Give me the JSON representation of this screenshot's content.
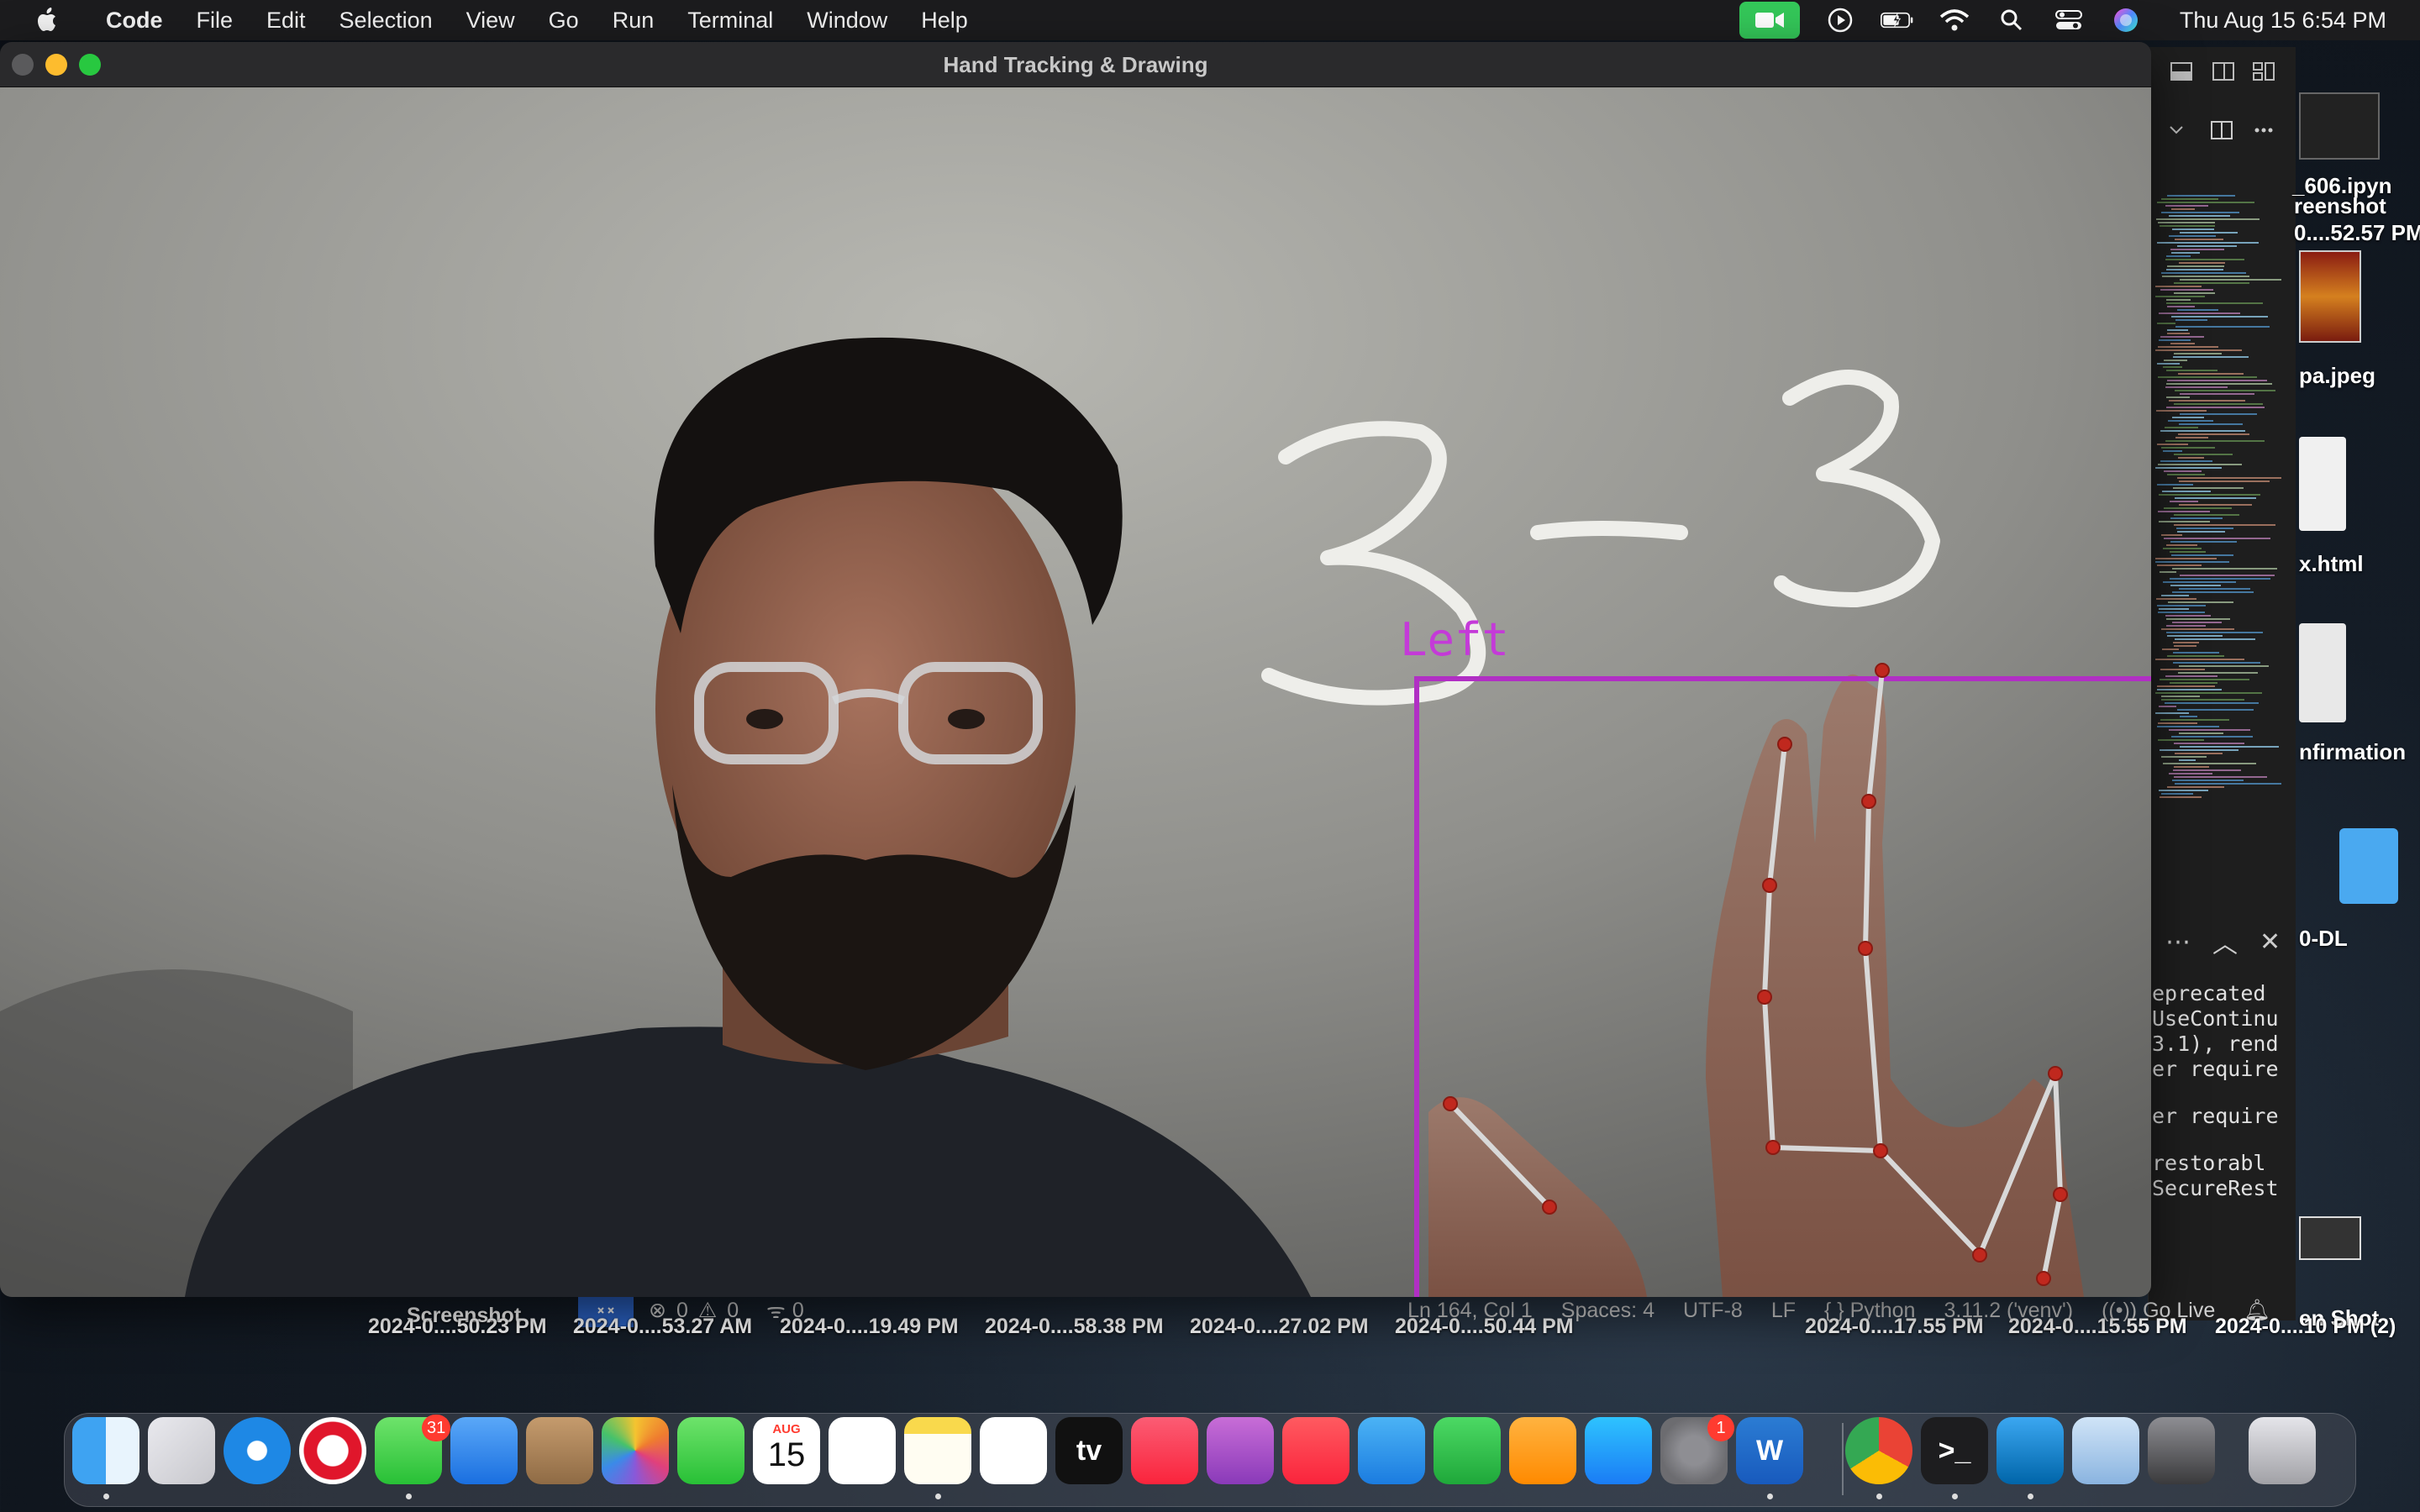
{
  "menubar": {
    "app_name": "Code",
    "items": [
      "File",
      "Edit",
      "Selection",
      "View",
      "Go",
      "Run",
      "Terminal",
      "Window",
      "Help"
    ],
    "clock": "Thu Aug 15  6:54 PM"
  },
  "camera_window": {
    "title": "Hand Tracking & Drawing",
    "drawing_text": "3-3",
    "hand_label": "Left",
    "accent_color": "#b12fc4"
  },
  "vscode": {
    "terminal_lines": [
      "eprecated",
      "UseContinu",
      "",
      "3.1), rend",
      "",
      "er require",
      "er require",
      "restorabl",
      "SecureRest"
    ],
    "status": {
      "errors": "0",
      "warnings": "0",
      "ports": "0",
      "position": "Ln 164, Col 1",
      "spaces": "Spaces: 4",
      "encoding": "UTF-8",
      "eol": "LF",
      "language": "Python",
      "interpreter": "3.11.2 ('venv')",
      "go_live": "Go Live"
    }
  },
  "desktop": {
    "files": [
      {
        "label": "_606.ipyn"
      },
      {
        "label": "reenshot"
      },
      {
        "label": "0....52.57 PM"
      },
      {
        "label": "pa.jpeg"
      },
      {
        "label": "x.html"
      },
      {
        "label": "nfirmation"
      },
      {
        "label": "0-DL"
      },
      {
        "label": "en Shot"
      }
    ],
    "screenshot_title": "Screenshot",
    "screenshot_names": [
      "2024-0....50.23 PM",
      "2024-0....53.27 AM",
      "2024-0....19.49 PM",
      "2024-0....58.38 PM",
      "2024-0....27.02 PM",
      "2024-0....50.44 PM"
    ],
    "screenshot_names_right": [
      "2024-0....17.55 PM",
      "2024-0....15.55 PM",
      "2024-0....10 PM (2)"
    ]
  },
  "dock": {
    "apps": [
      {
        "name": "Finder",
        "icon": "finder-icon"
      },
      {
        "name": "Launchpad",
        "icon": "launchpad-icon"
      },
      {
        "name": "Safari",
        "icon": "safari-icon"
      },
      {
        "name": "Opera",
        "icon": "opera-icon"
      },
      {
        "name": "Messages",
        "icon": "messages-icon",
        "badge": "31"
      },
      {
        "name": "Mail",
        "icon": "mail-icon"
      },
      {
        "name": "Contacts",
        "icon": "contacts-icon"
      },
      {
        "name": "Photos",
        "icon": "photos-icon"
      },
      {
        "name": "FaceTime",
        "icon": "facetime-icon"
      },
      {
        "name": "Calendar",
        "icon": "calendar-icon",
        "month": "AUG",
        "day": "15"
      },
      {
        "name": "Reminders",
        "icon": "reminders-icon"
      },
      {
        "name": "Notes",
        "icon": "notes-icon"
      },
      {
        "name": "Freeform",
        "icon": "freeform-icon"
      },
      {
        "name": "TV",
        "icon": "tv-icon",
        "label": "tv"
      },
      {
        "name": "Music",
        "icon": "music-icon"
      },
      {
        "name": "Podcasts",
        "icon": "podcasts-icon"
      },
      {
        "name": "News",
        "icon": "news-icon"
      },
      {
        "name": "Keynote",
        "icon": "keynote-icon"
      },
      {
        "name": "Numbers",
        "icon": "numbers-icon"
      },
      {
        "name": "Pages",
        "icon": "pages-icon"
      },
      {
        "name": "App Store",
        "icon": "app-store-icon"
      },
      {
        "name": "System Settings",
        "icon": "settings-icon",
        "badge": "1"
      },
      {
        "name": "Word",
        "icon": "word-icon",
        "label": "W"
      },
      {
        "name": "Chrome",
        "icon": "chrome-icon"
      },
      {
        "name": "Terminal",
        "icon": "terminal-icon",
        "label": ">_"
      },
      {
        "name": "VS Code",
        "icon": "vscode-icon"
      },
      {
        "name": "Preview",
        "icon": "preview-icon"
      },
      {
        "name": "Rocket",
        "icon": "rocket-icon"
      },
      {
        "name": "Trash",
        "icon": "trash-icon"
      }
    ]
  }
}
